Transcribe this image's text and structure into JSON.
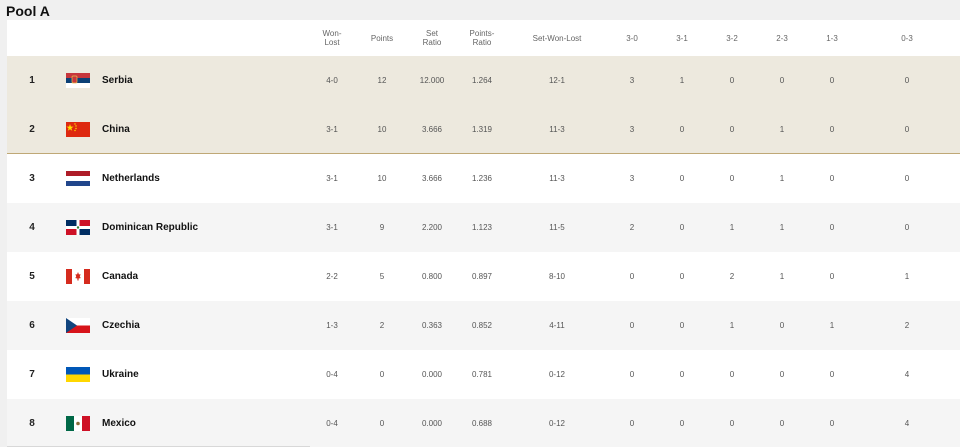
{
  "pool_title": "Pool A",
  "columns": {
    "won_lost": "Won-\nLost",
    "points": "Points",
    "set_ratio": "Set\nRatio",
    "points_ratio": "Points-\nRatio",
    "set_won_lost": "Set-Won-Lost",
    "r30": "3-0",
    "r31": "3-1",
    "r32": "3-2",
    "r23": "2-3",
    "r13": "1-3",
    "r03": "0-3"
  },
  "rows": [
    {
      "rank": "1",
      "team": "Serbia",
      "flag_icon": "serbia-flag-icon",
      "won_lost": "4-0",
      "points": "12",
      "set_ratio": "12.000",
      "points_ratio": "1.264",
      "set_won_lost": "12-1",
      "r30": "3",
      "r31": "1",
      "r32": "0",
      "r23": "0",
      "r13": "0",
      "r03": "0"
    },
    {
      "rank": "2",
      "team": "China",
      "flag_icon": "china-flag-icon",
      "won_lost": "3-1",
      "points": "10",
      "set_ratio": "3.666",
      "points_ratio": "1.319",
      "set_won_lost": "11-3",
      "r30": "3",
      "r31": "0",
      "r32": "0",
      "r23": "1",
      "r13": "0",
      "r03": "0"
    },
    {
      "rank": "3",
      "team": "Netherlands",
      "flag_icon": "netherlands-flag-icon",
      "won_lost": "3-1",
      "points": "10",
      "set_ratio": "3.666",
      "points_ratio": "1.236",
      "set_won_lost": "11-3",
      "r30": "3",
      "r31": "0",
      "r32": "0",
      "r23": "1",
      "r13": "0",
      "r03": "0"
    },
    {
      "rank": "4",
      "team": "Dominican Republic",
      "flag_icon": "dominican-republic-flag-icon",
      "won_lost": "3-1",
      "points": "9",
      "set_ratio": "2.200",
      "points_ratio": "1.123",
      "set_won_lost": "11-5",
      "r30": "2",
      "r31": "0",
      "r32": "1",
      "r23": "1",
      "r13": "0",
      "r03": "0"
    },
    {
      "rank": "5",
      "team": "Canada",
      "flag_icon": "canada-flag-icon",
      "won_lost": "2-2",
      "points": "5",
      "set_ratio": "0.800",
      "points_ratio": "0.897",
      "set_won_lost": "8-10",
      "r30": "0",
      "r31": "0",
      "r32": "2",
      "r23": "1",
      "r13": "0",
      "r03": "1"
    },
    {
      "rank": "6",
      "team": "Czechia",
      "flag_icon": "czechia-flag-icon",
      "won_lost": "1-3",
      "points": "2",
      "set_ratio": "0.363",
      "points_ratio": "0.852",
      "set_won_lost": "4-11",
      "r30": "0",
      "r31": "0",
      "r32": "1",
      "r23": "0",
      "r13": "1",
      "r03": "2"
    },
    {
      "rank": "7",
      "team": "Ukraine",
      "flag_icon": "ukraine-flag-icon",
      "won_lost": "0-4",
      "points": "0",
      "set_ratio": "0.000",
      "points_ratio": "0.781",
      "set_won_lost": "0-12",
      "r30": "0",
      "r31": "0",
      "r32": "0",
      "r23": "0",
      "r13": "0",
      "r03": "4"
    },
    {
      "rank": "8",
      "team": "Mexico",
      "flag_icon": "mexico-flag-icon",
      "won_lost": "0-4",
      "points": "0",
      "set_ratio": "0.000",
      "points_ratio": "0.688",
      "set_won_lost": "0-12",
      "r30": "0",
      "r31": "0",
      "r32": "0",
      "r23": "0",
      "r13": "0",
      "r03": "4"
    }
  ],
  "colors": {
    "qualified_row_bg": "#ede9de",
    "qualified_divider": "#bfa876",
    "alt_row_bg": "#f5f5f5"
  }
}
